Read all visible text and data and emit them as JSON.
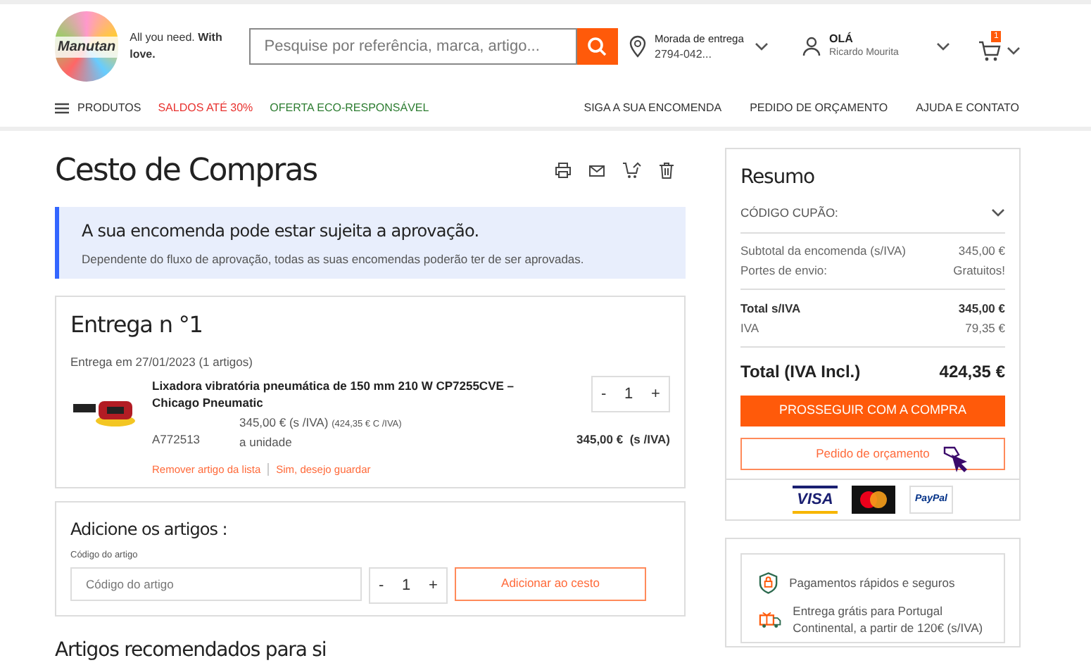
{
  "stepper": {
    "minus": "-",
    "plus": "+"
  },
  "header": {
    "logo": "Manutan",
    "tagline": "All you need. **With love.**",
    "search_placeholder": "Pesquise por referência, marca, artigo...",
    "delivery": {
      "label": "Morada de entrega",
      "value": "2794-042..."
    },
    "account": {
      "greeting": "OLÁ",
      "name": "Ricardo Mourita"
    },
    "cart_count": "1"
  },
  "nav": {
    "left": [
      {
        "label": "PRODUTOS",
        "kind": "menu"
      },
      {
        "label": "SALDOS ATÉ 30%",
        "kind": "sale"
      },
      {
        "label": "OFERTA ECO-RESPONSÁVEL",
        "kind": "eco"
      }
    ],
    "right": [
      "SIGA A SUA ENCOMENDA",
      "PEDIDO DE ORÇAMENTO",
      "AJUDA E CONTATO"
    ]
  },
  "page_title": "Cesto de Compras",
  "notice": {
    "title": "A sua encomenda pode estar sujeita a aprovação.",
    "text": "Dependente do fluxo de aprovação, todas as suas encomendas poderão ter de ser aprovadas."
  },
  "delivery_block": {
    "title": "Entrega n °1",
    "date": "Entrega em 27/01/2023 (1 artigos)",
    "item": {
      "name": "Lixadora vibratória pneumática de 150 mm 210 W CP7255CVE – Chicago Pneumatic",
      "price": "345,00 €",
      "price_note": "(s /IVA)",
      "price_vat": "(424,35 € C /IVA)",
      "unit": "a unidade",
      "ref": "A772513",
      "quantity": "1",
      "total": "345,00 €",
      "total_note": "(s /IVA)",
      "remove": "Remover artigo da lista",
      "save": "Sim, desejo guardar"
    }
  },
  "add_items": {
    "title": "Adicione os artigos :",
    "label": "Código do artigo",
    "placeholder": "Código do artigo",
    "quantity": "1",
    "button": "Adicionar ao cesto"
  },
  "recommended_title": "Artigos recomendados para si",
  "summary": {
    "title": "Resumo",
    "coupon": "CÓDIGO CUPÃO:",
    "lines": [
      {
        "label": "Subtotal da encomenda (s/IVA)",
        "value": "345,00 €",
        "kind": "plain"
      },
      {
        "label": "Portes de envio:",
        "value": "Gratuitos!",
        "kind": "plain"
      },
      {
        "label": "Total s/IVA",
        "value": "345,00 €",
        "kind": "bold",
        "divider": true
      },
      {
        "label": "IVA",
        "value": "79,35 €",
        "kind": "plain"
      }
    ],
    "total_label": "Total (IVA Incl.)",
    "total_value": "424,35 €",
    "primary_button": "PROSSEGUIR COM A COMPRA",
    "secondary_button": "Pedido de orçamento",
    "payments": [
      {
        "kind": "visa",
        "label": "VISA"
      },
      {
        "kind": "mastercard"
      },
      {
        "kind": "paypal",
        "label": "PayPal"
      }
    ]
  },
  "benefits": [
    {
      "kind": "secure",
      "text": "Pagamentos rápidos e seguros"
    },
    {
      "kind": "delivery",
      "text": "Entrega grátis para Portugal Continental, a partir de 120€ (s/IVA)"
    }
  ]
}
